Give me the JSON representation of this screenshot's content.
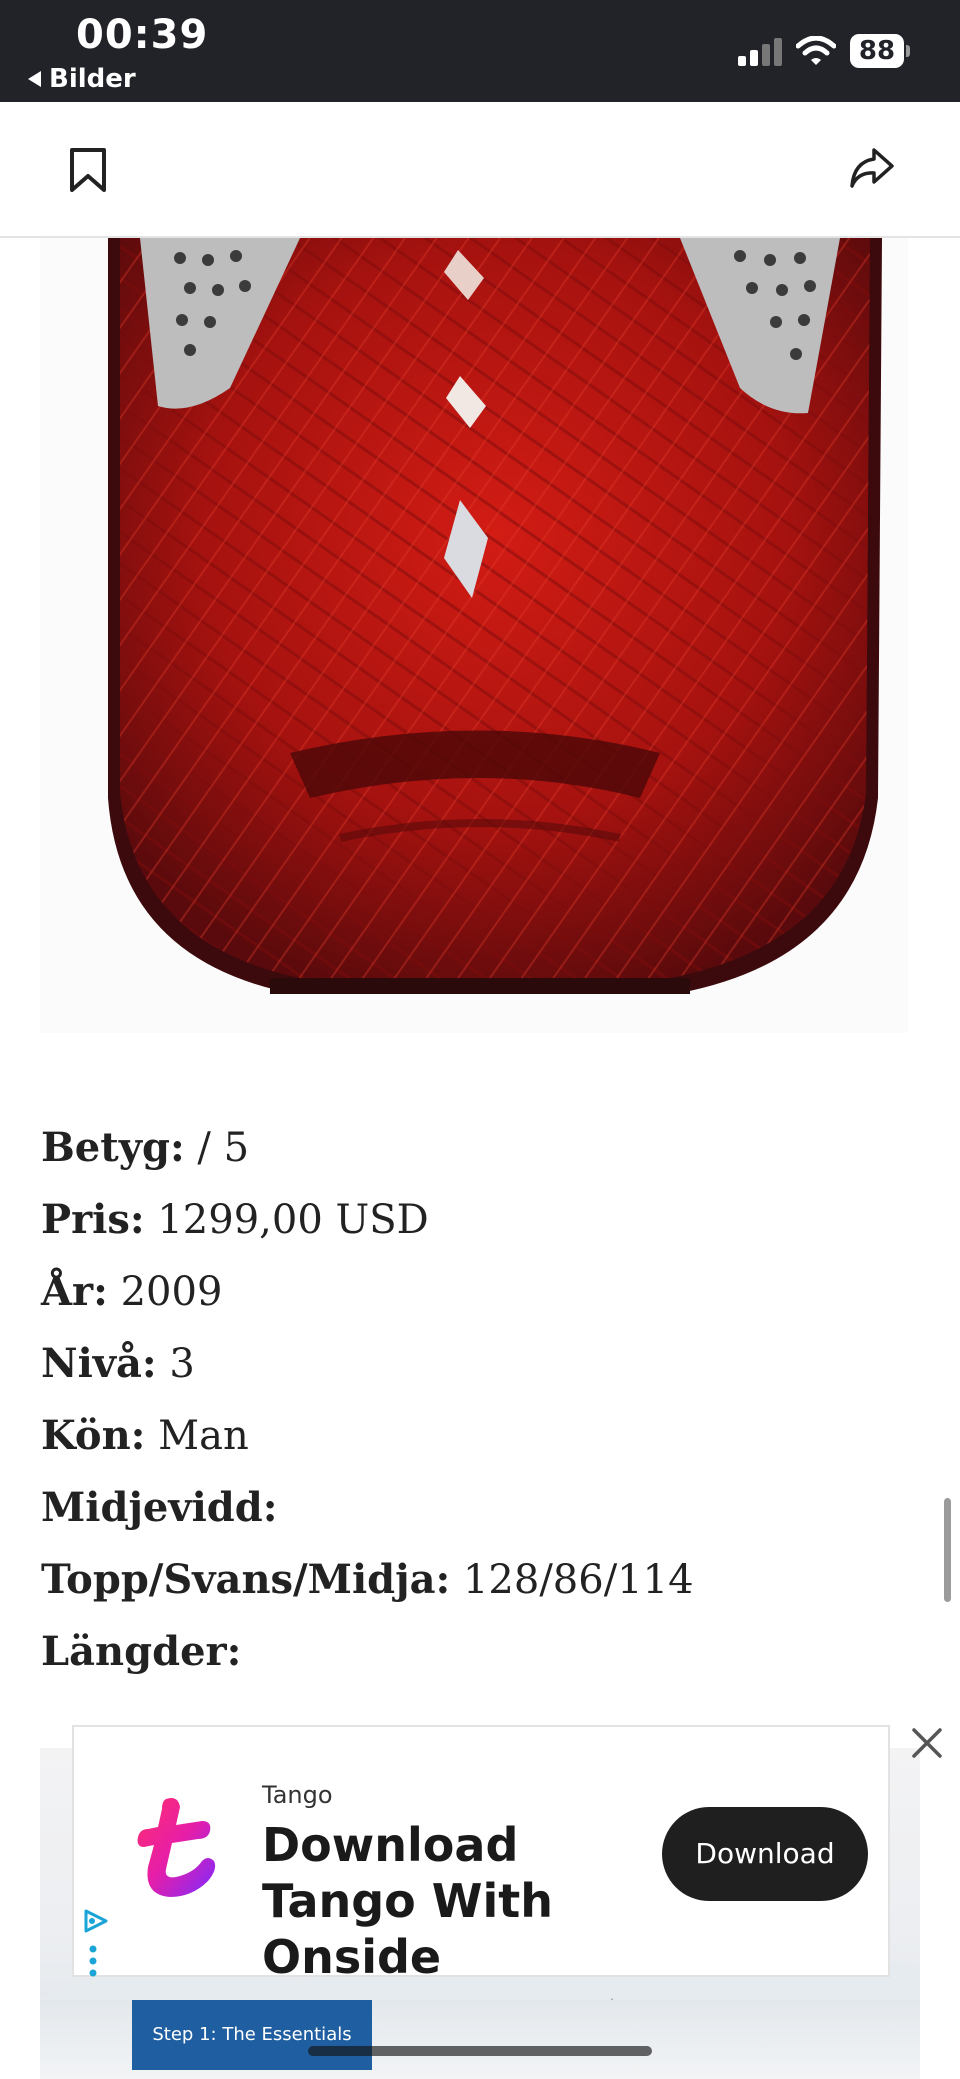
{
  "status_bar": {
    "time": "00:39",
    "back_label": "Bilder",
    "battery": "88"
  },
  "toolbar": {
    "bookmark_icon": "bookmark-icon",
    "share_icon": "share-icon"
  },
  "specs": [
    {
      "label": "Betyg:",
      "value": " / 5"
    },
    {
      "label": "Pris:",
      "value": " 1299,00 USD"
    },
    {
      "label": "År:",
      "value": " 2009"
    },
    {
      "label": "Nivå:",
      "value": " 3"
    },
    {
      "label": "Kön:",
      "value": " Man"
    },
    {
      "label": "Midjevidd:",
      "value": ""
    },
    {
      "label": "Topp/Svans/Midja:",
      "value": " 128/86/114"
    },
    {
      "label": "Längder:",
      "value": ""
    }
  ],
  "ad": {
    "brand": "Tango",
    "headline": "Download Tango With Onside",
    "cta": "Download",
    "banner_label": "Step 1: The Essentials",
    "cta_color": "#1f1f1f"
  },
  "colors": {
    "status_bar_bg": "#212328",
    "ski_red": "#b01414",
    "banner_blue": "#1f5ea0"
  }
}
